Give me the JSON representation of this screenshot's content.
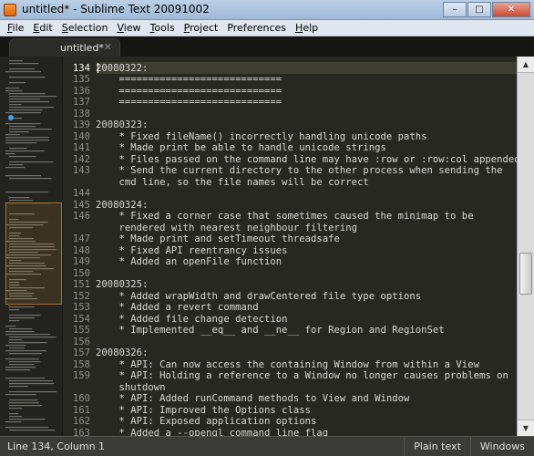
{
  "window": {
    "title": "untitled* - Sublime Text 20091002",
    "minimize": "–",
    "maximize": "□",
    "close": "✕",
    "app_icon": "sublime-orange-icon"
  },
  "menu": [
    {
      "key": "F",
      "rest": "ile"
    },
    {
      "key": "E",
      "rest": "dit"
    },
    {
      "key": "S",
      "rest": "election"
    },
    {
      "key": "V",
      "rest": "iew"
    },
    {
      "key": "T",
      "rest": "ools"
    },
    {
      "key": "P",
      "rest": "roject"
    },
    {
      "key": "",
      "rest": "Preferences"
    },
    {
      "key": "H",
      "rest": "elp"
    }
  ],
  "tab": {
    "label": "untitled*",
    "close": "✕"
  },
  "editor": {
    "current_line": 134,
    "lines": [
      {
        "n": "",
        "t": ""
      },
      {
        "n": "134",
        "t": "20080322:"
      },
      {
        "n": "135",
        "t": "    ============================"
      },
      {
        "n": "136",
        "t": "    ============================"
      },
      {
        "n": "137",
        "t": "    ============================"
      },
      {
        "n": "138",
        "t": ""
      },
      {
        "n": "139",
        "t": "20080323:"
      },
      {
        "n": "140",
        "t": "    * Fixed fileName() incorrectly handling unicode paths"
      },
      {
        "n": "141",
        "t": "    * Made print be able to handle unicode strings"
      },
      {
        "n": "142",
        "t": "    * Files passed on the command line may have :row or :row:col appended"
      },
      {
        "n": "143",
        "t": "    * Send the current directory to the other process when sending the"
      },
      {
        "n": "",
        "t": "    cmd line, so the file names will be correct"
      },
      {
        "n": "144",
        "t": ""
      },
      {
        "n": "145",
        "t": "20080324:"
      },
      {
        "n": "146",
        "t": "    * Fixed a corner case that sometimes caused the minimap to be"
      },
      {
        "n": "",
        "t": "    rendered with nearest neighbour filtering"
      },
      {
        "n": "147",
        "t": "    * Made print and setTimeout threadsafe"
      },
      {
        "n": "148",
        "t": "    * Fixed API reentrancy issues"
      },
      {
        "n": "149",
        "t": "    * Added an openFile function"
      },
      {
        "n": "150",
        "t": ""
      },
      {
        "n": "151",
        "t": "20080325:"
      },
      {
        "n": "152",
        "t": "    * Added wrapWidth and drawCentered file type options"
      },
      {
        "n": "153",
        "t": "    * Added a revert command"
      },
      {
        "n": "154",
        "t": "    * Added file change detection"
      },
      {
        "n": "155",
        "t": "    * Implemented __eq__ and __ne__ for Region and RegionSet"
      },
      {
        "n": "156",
        "t": ""
      },
      {
        "n": "157",
        "t": "20080326:"
      },
      {
        "n": "158",
        "t": "    * API: Can now access the containing Window from within a View"
      },
      {
        "n": "159",
        "t": "    * API: Holding a reference to a Window no longer causes problems on"
      },
      {
        "n": "",
        "t": "    shutdown"
      },
      {
        "n": "160",
        "t": "    * API: Added runCommand methods to View and Window"
      },
      {
        "n": "161",
        "t": "    * API: Improved the Options class"
      },
      {
        "n": "162",
        "t": "    * API: Exposed application options"
      },
      {
        "n": "163",
        "t": "    * Added a --opengl command line flag"
      }
    ]
  },
  "scrollbar": {
    "up": "▲",
    "down": "▼",
    "position_fraction": 0.55
  },
  "status": {
    "position": "Line 134, Column 1",
    "syntax": "Plain text",
    "line_endings": "Windows"
  }
}
